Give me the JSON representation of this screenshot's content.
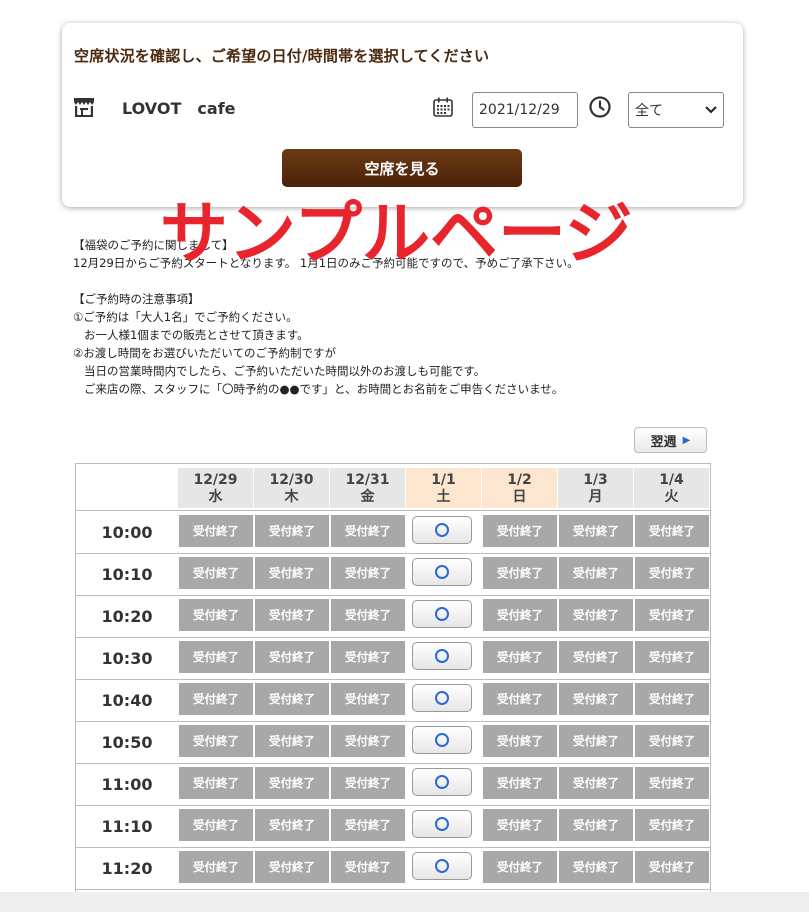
{
  "search": {
    "title": "空席状況を確認し、ご希望の日付/時間帯を選択してください",
    "store_name": "LOVOT　cafe",
    "date_value": "2021/12/29",
    "time_value": "全て",
    "view_button": "空席を見る"
  },
  "watermark": "サンプルページ",
  "notice": [
    "【福袋のご予約に関しまして】",
    "12月29日からご予約スタートとなります。 1月1日のみご予約可能ですので、予めご了承下さい。",
    "",
    "【ご予約時の注意事項】",
    "①ご予約は「大人1名」でご予約ください。",
    "   お一人様1個までの販売とさせて頂きます。",
    "②お渡し時間をお選びいただいてのご予約制ですが",
    "   当日の営業時間内でしたら、ご予約いただいた時間以外のお渡しも可能です。",
    "   ご来店の際、スタッフに「〇時予約の●●です」と、お時間とお名前をご申告くださいませ。"
  ],
  "next_week_label": "翌週",
  "days": [
    {
      "date": "12/29",
      "weekday": "水",
      "highlight": false
    },
    {
      "date": "12/30",
      "weekday": "木",
      "highlight": false
    },
    {
      "date": "12/31",
      "weekday": "金",
      "highlight": false
    },
    {
      "date": "1/1",
      "weekday": "土",
      "highlight": true
    },
    {
      "date": "1/2",
      "weekday": "日",
      "highlight": true
    },
    {
      "date": "1/3",
      "weekday": "月",
      "highlight": false
    },
    {
      "date": "1/4",
      "weekday": "火",
      "highlight": false
    }
  ],
  "closed_label": "受付終了",
  "rows": [
    {
      "time": "10:00",
      "status": [
        "closed",
        "closed",
        "closed",
        "open",
        "closed",
        "closed",
        "closed"
      ]
    },
    {
      "time": "10:10",
      "status": [
        "closed",
        "closed",
        "closed",
        "open",
        "closed",
        "closed",
        "closed"
      ]
    },
    {
      "time": "10:20",
      "status": [
        "closed",
        "closed",
        "closed",
        "open",
        "closed",
        "closed",
        "closed"
      ]
    },
    {
      "time": "10:30",
      "status": [
        "closed",
        "closed",
        "closed",
        "open",
        "closed",
        "closed",
        "closed"
      ]
    },
    {
      "time": "10:40",
      "status": [
        "closed",
        "closed",
        "closed",
        "open",
        "closed",
        "closed",
        "closed"
      ]
    },
    {
      "time": "10:50",
      "status": [
        "closed",
        "closed",
        "closed",
        "open",
        "closed",
        "closed",
        "closed"
      ]
    },
    {
      "time": "11:00",
      "status": [
        "closed",
        "closed",
        "closed",
        "open",
        "closed",
        "closed",
        "closed"
      ]
    },
    {
      "time": "11:10",
      "status": [
        "closed",
        "closed",
        "closed",
        "open",
        "closed",
        "closed",
        "closed"
      ]
    },
    {
      "time": "11:20",
      "status": [
        "closed",
        "closed",
        "closed",
        "open",
        "closed",
        "closed",
        "closed"
      ]
    }
  ],
  "colors": {
    "brand": "#4a220a",
    "watermark": "#e8242c",
    "holiday_header": "#fde6d0",
    "closed_cell": "#a8a8a8",
    "open_circle": "#2a6ad6"
  }
}
